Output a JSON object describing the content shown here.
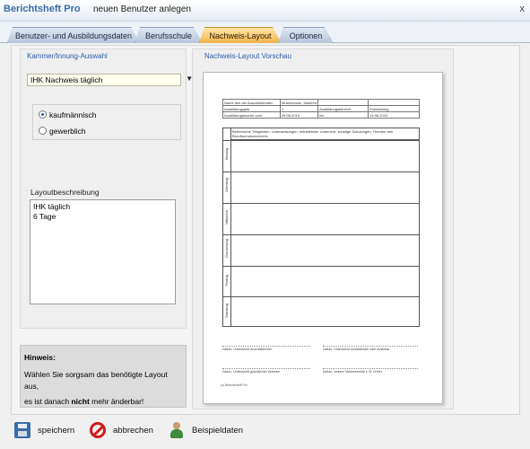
{
  "window": {
    "app_title": "Berichtsheft Pro",
    "subtitle": "neuen Benutzer anlegen",
    "close_glyph": "x"
  },
  "tabs": [
    {
      "label": "Benutzer- und Ausbildungsdaten",
      "active": false
    },
    {
      "label": "Berufsschule",
      "active": false
    },
    {
      "label": "Nachweis-Layout",
      "active": true
    },
    {
      "label": "Optionen",
      "active": false
    }
  ],
  "left": {
    "section_title": "Kammer/Innung-Auswahl",
    "select_value": "IHK Nachweis täglich",
    "radio_options": [
      {
        "label": "kaufmännisch",
        "selected": true
      },
      {
        "label": "gewerblich",
        "selected": false
      }
    ],
    "description_label": "Layoutbeschreibung",
    "description_text": "IHK täglich\n6 Tage"
  },
  "hint": {
    "title": "Hinweis:",
    "line1": "Wählen Sie sorgsam das benötigte Layout aus,",
    "line2_pre": "es ist danach",
    "line2_bold": "nicht",
    "line2_post": "mehr änderbar!"
  },
  "preview": {
    "section_title": "Nachweis-Layout Vorschau",
    "header_rows": [
      [
        "Name des der Auszubildenden",
        "Mustermann, Manfred",
        "",
        ""
      ],
      [
        "Ausbildungsjahr",
        "1",
        "Ausbildungsbereich",
        "Entwicklung"
      ],
      [
        "Ausbildungswoche vom",
        "09.08.2010",
        "bis",
        "14.08.2010"
      ]
    ],
    "grid_header": "Betriebliche Tätigkeiten, Unterweisungen, betrieblicher Unterricht, sonstige Schulungen, Themen des Berufsschulunterrichts",
    "days": [
      "Montag",
      "Dienstag",
      "Mittwoch",
      "Donnerstag",
      "Freitag",
      "Samstag"
    ],
    "signatures": [
      "Datum, Unterschrift Auszubildender",
      "Datum, Unterschrift Ausbildender oder Ausbilder",
      "Datum, Unterschrift gesetzlicher Vertreter",
      "Datum, weitere Sichtvermerke z. B. Lehrer"
    ],
    "footnote": "(c) Berichtsheft Pro"
  },
  "actions": {
    "save_label": "speichern",
    "cancel_label": "abbrechen",
    "sample_label": "Beispieldaten"
  }
}
